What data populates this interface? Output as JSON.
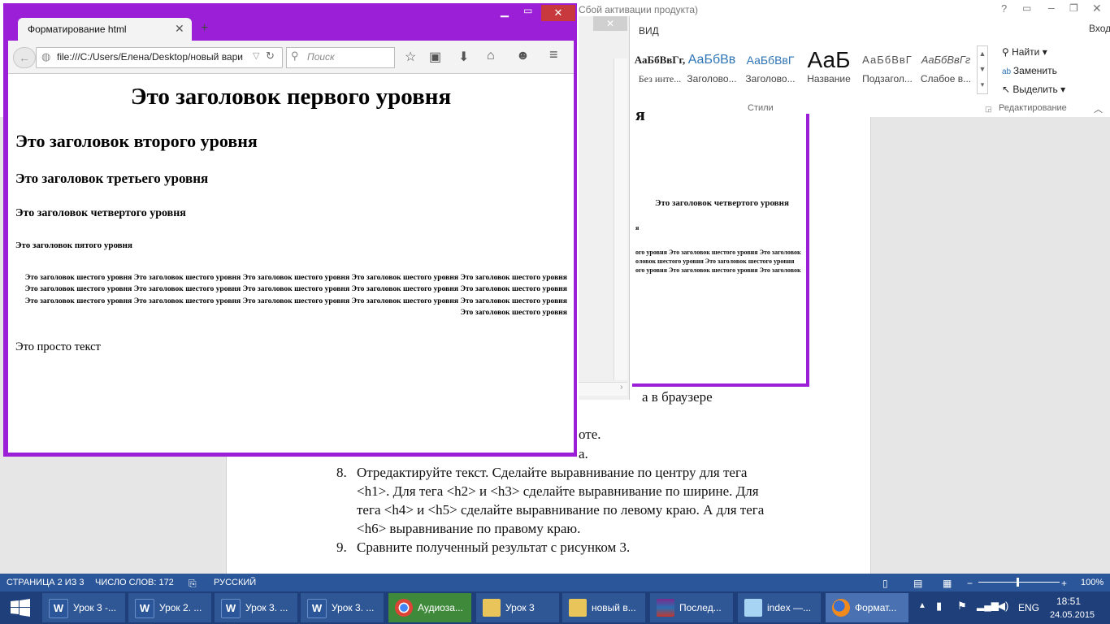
{
  "word": {
    "title": "Сбой активации продукта)",
    "tabs": {
      "view": "ВИД",
      "signin": "Вход"
    },
    "styles": [
      {
        "sample": "АаБбВвГг,",
        "name": "Без инте..."
      },
      {
        "sample": "АаБбВв",
        "name": "Заголово..."
      },
      {
        "sample": "АаБбВвГ",
        "name": "Заголово..."
      },
      {
        "sample": "АаБ",
        "name": "Название"
      },
      {
        "sample": "АаБбВвГ",
        "name": "Подзагол..."
      },
      {
        "sample": "АаБбВвГг",
        "name": "Слабое в..."
      }
    ],
    "group_styles": "Стили",
    "group_edit": "Редактирование",
    "edit": {
      "find": "Найти",
      "replace": "Заменить",
      "select": "Выделить"
    },
    "doc_lines": {
      "l1": "а в браузере",
      "l2": "оте.",
      "l3": "а.",
      "item8_num": "8.",
      "item8_a": "Отредактируйте текст. Сделайте выравнивание по центру для тега",
      "item8_b": "<h1>. Для тега <h2> и <h3> сделайте выравнивание по ширине. Для",
      "item8_c": "тега <h4> и <h5> сделайте выравнивание по левому краю. А для тега",
      "item8_d": "<h6> выравнивание по правому краю.",
      "item9_num": "9.",
      "item9": "Сравните полученный результат с рисунком 3."
    },
    "image": {
      "h4": "Это заголовок четвертого уровня",
      "h6a": "ого уровня Это заголовок шестого уровня Это заголовок",
      "h6b": "оловок шестого уровня Это заголовок шестого уровня",
      "h6c": "ого уровня Это заголовок шестого уровня Это заголовок"
    },
    "status": {
      "page": "СТРАНИЦА 2 ИЗ 3",
      "words": "ЧИСЛО СЛОВ: 172",
      "lang": "РУССКИЙ",
      "zoom": "100%"
    }
  },
  "firefox": {
    "tab_title": "Форматирование html",
    "url": "file:///C:/Users/Елена/Desktop/новый вари",
    "search_placeholder": "Поиск",
    "content": {
      "h1": "Это заголовок первого уровня",
      "h2": "Это заголовок второго уровня",
      "h3": "Это заголовок третьего уровня",
      "h4": "Это заголовок четвертого уровня",
      "h5": "Это заголовок пятого уровня",
      "h6": "Это заголовок шестого уровня Это заголовок шестого уровня Это заголовок шестого уровня Это заголовок шестого уровня Это заголовок шестого уровня Это заголовок шестого уровня Это заголовок шестого уровня Это заголовок шестого уровня Это заголовок шестого уровня Это заголовок шестого уровня Это заголовок шестого уровня Это заголовок шестого уровня Это заголовок шестого уровня Это заголовок шестого уровня Это заголовок шестого уровня Это заголовок шестого уровня",
      "p": "Это просто текст"
    }
  },
  "taskbar": {
    "items": [
      {
        "label": "Урок 3 -...",
        "icon": "W"
      },
      {
        "label": "Урок 2. ...",
        "icon": "W"
      },
      {
        "label": "Урок 3. ...",
        "icon": "W"
      },
      {
        "label": "Урок 3. ...",
        "icon": "W"
      },
      {
        "label": "Аудиоза...",
        "icon": "chrome"
      },
      {
        "label": "Урок 3",
        "icon": "folder"
      },
      {
        "label": "новый в...",
        "icon": "folder"
      },
      {
        "label": "Послед...",
        "icon": "winrar"
      },
      {
        "label": "index —...",
        "icon": "notepad"
      },
      {
        "label": "Формат...",
        "icon": "firefox"
      }
    ],
    "lang": "ENG",
    "time": "18:51",
    "date": "24.05.2015"
  },
  "colors": {
    "frame": "#9b1fd6",
    "word_blue": "#2b579a",
    "taskbar": "#1e3f7a"
  }
}
